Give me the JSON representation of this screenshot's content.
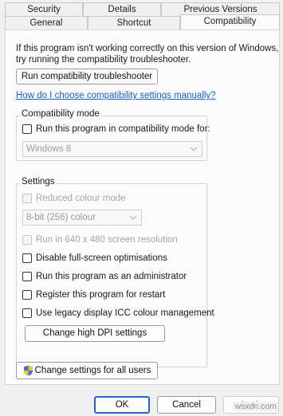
{
  "tabs": {
    "back": [
      "Security",
      "Details",
      "Previous Versions"
    ],
    "front": [
      "General",
      "Shortcut",
      "Compatibility"
    ],
    "active": "Compatibility"
  },
  "intro": "If this program isn't working correctly on this version of Windows, try running the compatibility troubleshooter.",
  "intro_line1": "If this program isn't working correctly on this version of Windows,",
  "intro_line2": "try running the compatibility troubleshooter.",
  "troubleshooter_button": "Run compatibility troubleshooter",
  "manual_link": "How do I choose compatibility settings manually?",
  "compat_mode": {
    "legend": "Compatibility mode",
    "checkbox": "Run this program in compatibility mode for:",
    "checked": false,
    "selected_os": "Windows 8"
  },
  "settings": {
    "legend": "Settings",
    "reduced_colour": {
      "label": "Reduced colour mode",
      "enabled": false,
      "checked": false
    },
    "colour_depth": "8-bit (256) colour",
    "resolution": {
      "label": "Run in 640 x 480 screen resolution",
      "enabled": false,
      "checked": false
    },
    "disable_fullscreen": {
      "label": "Disable full-screen optimisations",
      "checked": false
    },
    "run_as_admin": {
      "label": "Run this program as an administrator",
      "checked": false
    },
    "register_restart": {
      "label": "Register this program for restart",
      "checked": false
    },
    "legacy_icc": {
      "label": "Use legacy display ICC colour management",
      "checked": false
    },
    "dpi_button": "Change high DPI settings"
  },
  "all_users_button": "Change settings for all users",
  "footer": {
    "ok": "OK",
    "cancel": "Cancel",
    "apply": "Apply"
  },
  "watermark": "wsxdn.com",
  "colors": {
    "link": "#1a5fc4",
    "panel": "#fbfbfb",
    "dialog_bg": "#f0f0f0"
  }
}
